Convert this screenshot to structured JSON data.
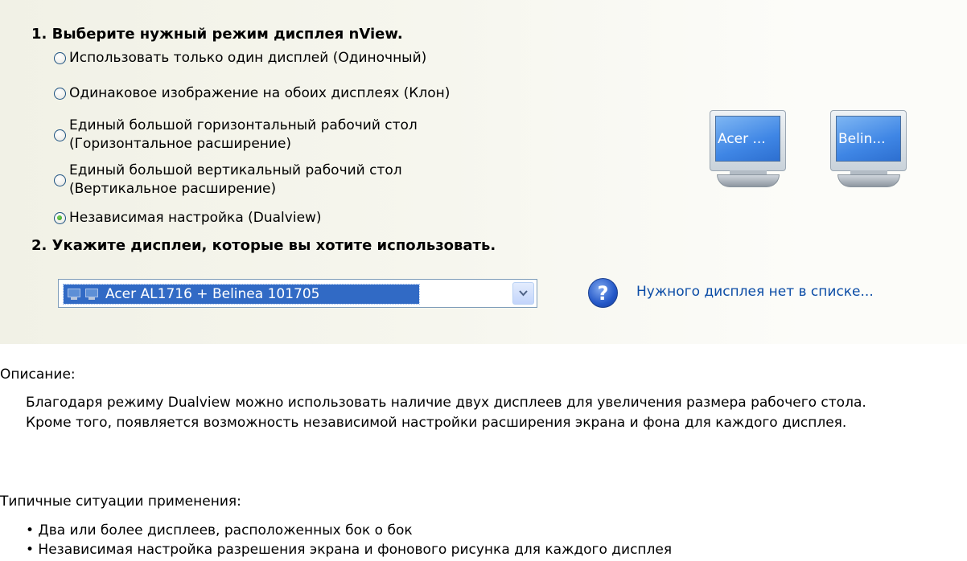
{
  "step1": {
    "heading": "1. Выберите нужный режим дисплея nView.",
    "options": [
      {
        "label": "Использовать только один дисплей (Одиночный)",
        "checked": false
      },
      {
        "label": "Одинаковое изображение на обоих дисплеях (Клон)",
        "checked": false
      },
      {
        "label_line1": "Единый большой горизонтальный рабочий стол",
        "label_line2": "(Горизонтальное расширение)",
        "checked": false
      },
      {
        "label_line1": "Единый большой вертикальный рабочий стол",
        "label_line2": "(Вертикальное расширение)",
        "checked": false
      },
      {
        "label": "Независимая настройка (Dualview)",
        "checked": true
      }
    ]
  },
  "monitors": [
    {
      "label": "Acer ..."
    },
    {
      "label": "Belin..."
    }
  ],
  "step2": {
    "heading": "2. Укажите дисплеи, которые вы хотите использовать.",
    "selected_display": "Acer AL1716 + Belinea 101705",
    "help_icon": "question-mark-icon",
    "help_link": "Нужного дисплея нет в списке..."
  },
  "description": {
    "label": "Описание:",
    "line1": "Благодаря режиму Dualview можно использовать наличие двух дисплеев для увеличения размера рабочего стола.",
    "line2": "Кроме того, появляется возможность независимой настройки расширения экрана и фона для каждого дисплея."
  },
  "usage": {
    "label": "Типичные ситуации применения:",
    "items": [
      "• Два или более дисплеев, расположенных бок о бок",
      "• Независимая настройка разрешения экрана и фонового рисунка для каждого дисплея"
    ]
  },
  "colors": {
    "selection": "#316ac5",
    "link": "#0b4ca6",
    "panel": "#f1f1e6"
  }
}
